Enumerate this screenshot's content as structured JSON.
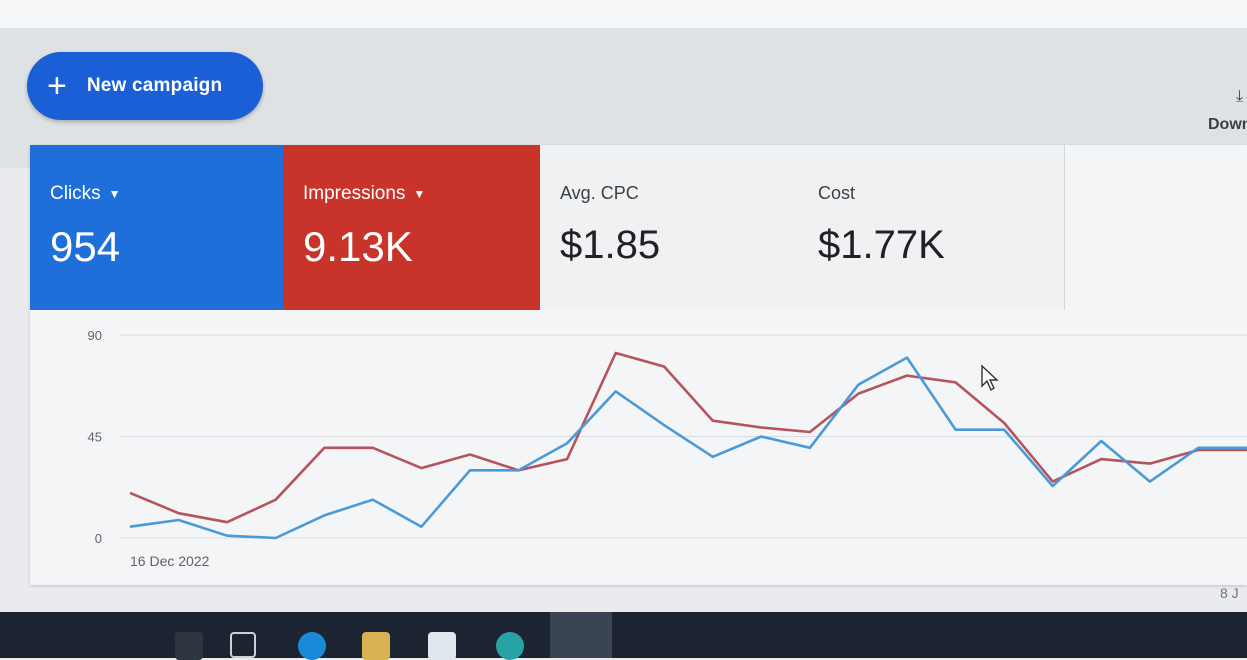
{
  "toolbar": {
    "new_campaign_label": "New campaign",
    "new_campaign_icon": "plus-icon",
    "download_label": "Down",
    "download_icon": "download-icon"
  },
  "metrics": [
    {
      "label": "Clicks",
      "value": "954",
      "has_dropdown": true,
      "color": "#1f6fdb"
    },
    {
      "label": "Impressions",
      "value": "9.13K",
      "has_dropdown": true,
      "color": "#c8342a"
    },
    {
      "label": "Avg. CPC",
      "value": "$1.85",
      "has_dropdown": false
    },
    {
      "label": "Cost",
      "value": "$1.77K",
      "has_dropdown": false
    }
  ],
  "chart_data": {
    "type": "line",
    "ylim": [
      0,
      90
    ],
    "y_ticks": [
      "90",
      "45",
      "0"
    ],
    "x_start_label": "16 Dec 2022",
    "x_end_label": "8 J",
    "x": [
      1,
      2,
      3,
      4,
      5,
      6,
      7,
      8,
      9,
      10,
      11,
      12,
      13,
      14,
      15,
      16,
      17,
      18,
      19,
      20,
      21,
      22,
      23,
      24
    ],
    "series": [
      {
        "name": "Clicks",
        "color": "#4a9ad8",
        "values": [
          5,
          8,
          1,
          0,
          10,
          17,
          5,
          30,
          30,
          42,
          65,
          50,
          36,
          45,
          40,
          68,
          80,
          48,
          48,
          23,
          43,
          25,
          40,
          40
        ]
      },
      {
        "name": "Impressions",
        "color": "#b5545d",
        "values": [
          20,
          11,
          7,
          17,
          40,
          40,
          31,
          37,
          30,
          35,
          82,
          76,
          52,
          49,
          47,
          64,
          72,
          69,
          51,
          25,
          35,
          33,
          39,
          39
        ]
      }
    ]
  }
}
